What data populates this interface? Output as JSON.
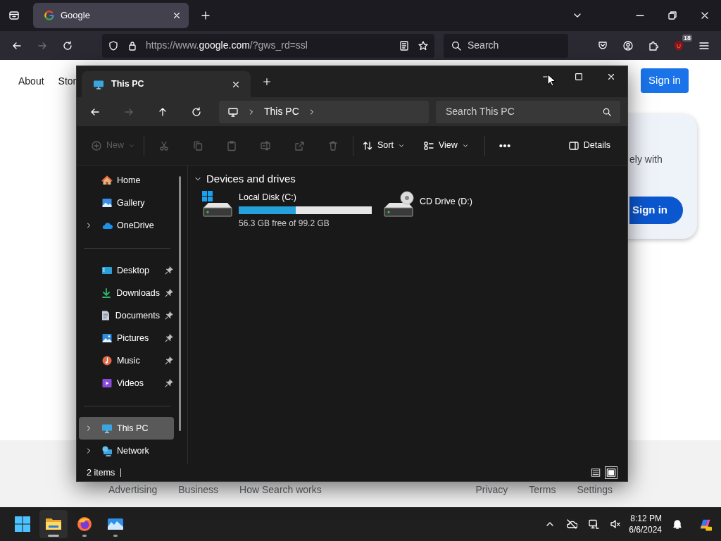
{
  "browser": {
    "tabs": [
      {
        "title": "Google",
        "selected": true
      }
    ],
    "nav": [
      {
        "kind": "back",
        "disabled": false
      },
      {
        "kind": "forward",
        "disabled": true
      },
      {
        "kind": "reload",
        "disabled": false
      }
    ],
    "url": {
      "prefix": "https://www.",
      "domain": "google.com",
      "suffix": "/?gws_rd=ssl"
    },
    "search": {
      "placeholder": "Search"
    },
    "extension_badge": "18"
  },
  "google_page": {
    "header_links": [
      "About",
      "Stor"
    ],
    "sign_in": "Sign in",
    "card": {
      "text": "ely with",
      "button": "Sign in"
    },
    "footer_left": [
      "Advertising",
      "Business",
      "How Search works"
    ],
    "footer_right": [
      "Privacy",
      "Terms",
      "Settings"
    ]
  },
  "explorer": {
    "tabs": [
      {
        "title": "This PC",
        "selected": true
      }
    ],
    "nav": [
      {
        "kind": "back",
        "disabled": false
      },
      {
        "kind": "forward",
        "disabled": true
      },
      {
        "kind": "up",
        "disabled": false
      },
      {
        "kind": "refresh",
        "disabled": false
      }
    ],
    "breadcrumb": [
      "This PC"
    ],
    "search": {
      "placeholder": "Search This PC"
    },
    "toolbar": [
      [
        {
          "kind": "new",
          "label": "New",
          "menu": true,
          "disabled": true
        }
      ],
      [
        {
          "kind": "cut",
          "disabled": true
        },
        {
          "kind": "copy",
          "disabled": true
        },
        {
          "kind": "paste",
          "disabled": true
        },
        {
          "kind": "rename",
          "disabled": true
        },
        {
          "kind": "share",
          "disabled": true
        },
        {
          "kind": "delete",
          "disabled": true
        }
      ],
      [
        {
          "kind": "sort",
          "label": "Sort",
          "menu": true,
          "disabled": false
        },
        {
          "kind": "view",
          "label": "View",
          "menu": true,
          "disabled": false
        }
      ],
      [
        {
          "kind": "more",
          "disabled": false
        }
      ]
    ],
    "details_button": "Details",
    "sidebar": [
      [
        {
          "kind": "home",
          "label": "Home",
          "expandable": false,
          "pinned": false,
          "selected": false
        },
        {
          "kind": "gallery",
          "label": "Gallery",
          "expandable": false,
          "pinned": false,
          "selected": false
        },
        {
          "kind": "onedrive",
          "label": "OneDrive",
          "expandable": true,
          "pinned": false,
          "selected": false
        }
      ],
      [
        {
          "kind": "desktop",
          "label": "Desktop",
          "expandable": false,
          "pinned": true,
          "selected": false
        },
        {
          "kind": "downloads",
          "label": "Downloads",
          "expandable": false,
          "pinned": true,
          "selected": false
        },
        {
          "kind": "documents",
          "label": "Documents",
          "expandable": false,
          "pinned": true,
          "selected": false
        },
        {
          "kind": "pictures",
          "label": "Pictures",
          "expandable": false,
          "pinned": true,
          "selected": false
        },
        {
          "kind": "music",
          "label": "Music",
          "expandable": false,
          "pinned": true,
          "selected": false
        },
        {
          "kind": "videos",
          "label": "Videos",
          "expandable": false,
          "pinned": true,
          "selected": false
        }
      ],
      [
        {
          "kind": "thispc",
          "label": "This PC",
          "expandable": true,
          "pinned": false,
          "selected": true
        },
        {
          "kind": "network",
          "label": "Network",
          "expandable": true,
          "pinned": false,
          "selected": false
        }
      ]
    ],
    "group": {
      "title": "Devices and drives",
      "expanded": true
    },
    "drives": [
      {
        "kind": "disk",
        "name": "Local Disk (C:)",
        "level": 0.43,
        "free": "56.3 GB free of 99.2 GB"
      },
      {
        "kind": "cd",
        "name": "CD Drive (D:)"
      }
    ],
    "status": {
      "count": "2 items",
      "views": [
        {
          "kind": "details",
          "selected": false
        },
        {
          "kind": "tiles",
          "selected": true
        }
      ]
    }
  },
  "taskbar": {
    "apps": [
      {
        "kind": "explorer",
        "active": true,
        "running": true
      },
      {
        "kind": "firefox",
        "active": false,
        "running": true
      },
      {
        "kind": "photos",
        "active": false,
        "running": true
      }
    ],
    "time": "8:12 PM",
    "date": "6/6/2024"
  }
}
